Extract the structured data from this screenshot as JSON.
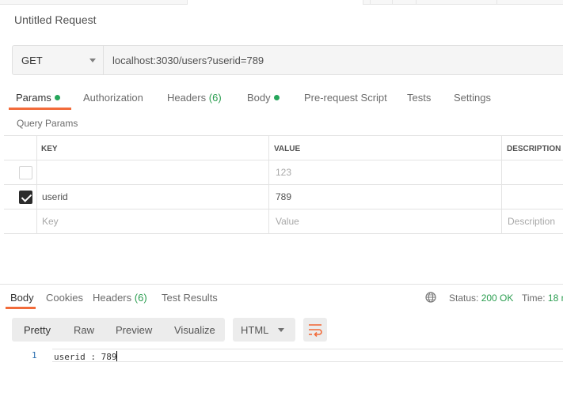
{
  "request": {
    "title": "Untitled Request",
    "method": "GET",
    "url": "localhost:3030/users?userid=789"
  },
  "tabs": [
    {
      "label": "Params",
      "dot": true
    },
    {
      "label": "Authorization"
    },
    {
      "label": "Headers",
      "count": "(6)"
    },
    {
      "label": "Body",
      "dot": true
    },
    {
      "label": "Pre-request Script"
    },
    {
      "label": "Tests"
    },
    {
      "label": "Settings"
    }
  ],
  "query_params": {
    "section_label": "Query Params",
    "headers": {
      "key": "KEY",
      "value": "VALUE",
      "description": "DESCRIPTION"
    },
    "rows": [
      {
        "checked": false,
        "key": "",
        "value": "123",
        "description": ""
      },
      {
        "checked": true,
        "key": "userid",
        "value": "789",
        "description": ""
      }
    ],
    "placeholders": {
      "key": "Key",
      "value": "Value",
      "description": "Description"
    }
  },
  "response": {
    "tabs": [
      {
        "label": "Body"
      },
      {
        "label": "Cookies"
      },
      {
        "label": "Headers",
        "count": "(6)"
      },
      {
        "label": "Test Results"
      }
    ],
    "status_label": "Status:",
    "status_value": "200 OK",
    "time_label": "Time:",
    "time_value": "18 n",
    "views": [
      "Pretty",
      "Raw",
      "Preview",
      "Visualize"
    ],
    "format": "HTML",
    "lines": [
      {
        "number": "1",
        "text": "userid : 789"
      }
    ]
  },
  "colors": {
    "accent": "#f26b3a",
    "success": "#2a9d4f",
    "dot": "#26a65b"
  },
  "icons": [
    "globe-icon",
    "wrap-lines-icon",
    "chevron-down-icon",
    "checkbox-icon"
  ]
}
